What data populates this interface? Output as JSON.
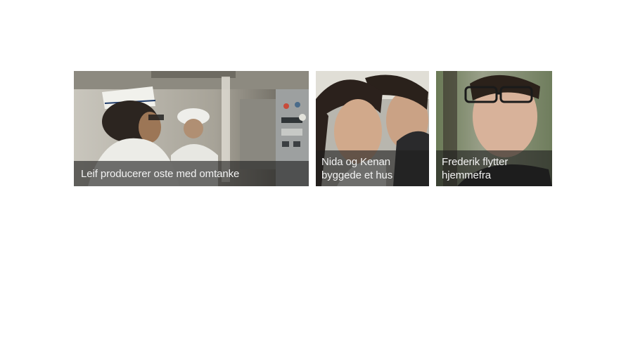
{
  "tiles": [
    {
      "caption": "Leif producerer oste med omtanke"
    },
    {
      "caption": "Nida og Kenan byggede et hus"
    },
    {
      "caption": "Frederik flytter hjemmefra"
    }
  ]
}
